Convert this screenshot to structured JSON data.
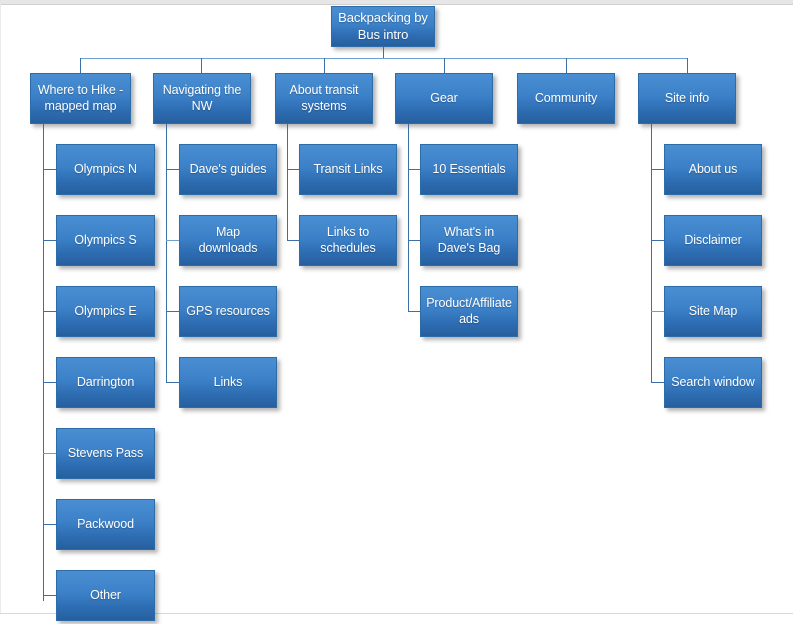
{
  "diagram": {
    "type": "sitemap-org-chart",
    "accent_color": "#3c81c8",
    "accent_dark": "#265f9f",
    "connector_color": "#3a6fa8",
    "background": "#ffffff",
    "root": {
      "label": "Backpacking by Bus intro"
    },
    "branches": [
      {
        "id": "where-to-hike",
        "label": "Where to Hike - mapped map",
        "children": [
          {
            "label": "Olympics N"
          },
          {
            "label": "Olympics S"
          },
          {
            "label": "Olympics E"
          },
          {
            "label": "Darrington"
          },
          {
            "label": "Stevens Pass"
          },
          {
            "label": "Packwood"
          },
          {
            "label": "Other"
          }
        ]
      },
      {
        "id": "navigating-the-nw",
        "label": "Navigating  the NW",
        "children": [
          {
            "label": "Dave's guides"
          },
          {
            "label": "Map downloads"
          },
          {
            "label": "GPS resources"
          },
          {
            "label": "Links"
          }
        ]
      },
      {
        "id": "about-transit-systems",
        "label": "About transit systems",
        "children": [
          {
            "label": "Transit Links"
          },
          {
            "label": "Links to schedules"
          }
        ]
      },
      {
        "id": "gear",
        "label": "Gear",
        "children": [
          {
            "label": "10 Essentials"
          },
          {
            "label": "What's in Dave's Bag"
          },
          {
            "label": "Product/Affiliate ads"
          }
        ]
      },
      {
        "id": "community",
        "label": "Community",
        "children": []
      },
      {
        "id": "site-info",
        "label": "Site info",
        "children": [
          {
            "label": "About us"
          },
          {
            "label": "Disclaimer"
          },
          {
            "label": "Site Map"
          },
          {
            "label": "Search window"
          }
        ]
      }
    ]
  }
}
